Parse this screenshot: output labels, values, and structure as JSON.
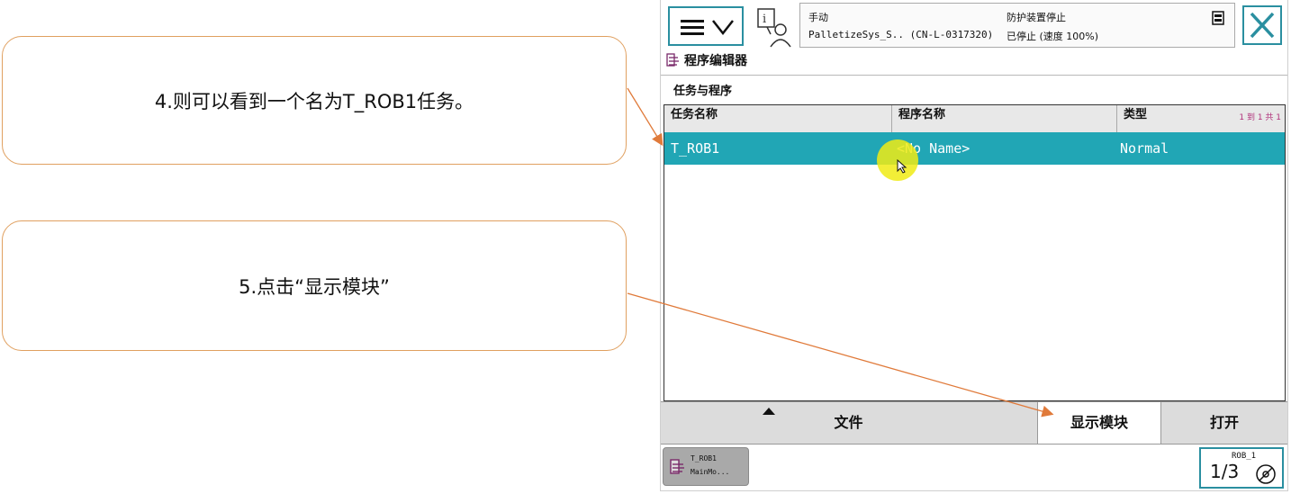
{
  "callouts": {
    "step4": "4.则可以看到一个名为T_ROB1任务。",
    "step5": "5.点击“显示模块”"
  },
  "header": {
    "mode": "手动",
    "system": "PalletizeSys_S.. (CN-L-0317320)",
    "guard": "防护装置停止",
    "state": "已停止 (速度 100%)"
  },
  "window": {
    "title": "程序编辑器",
    "section": "任务与程序"
  },
  "table": {
    "columns": [
      "任务名称",
      "程序名称",
      "类型"
    ],
    "pager": "1 到 1 共 1",
    "rows": [
      {
        "task": "T_ROB1",
        "program": "<No Name>",
        "type": "Normal"
      }
    ]
  },
  "toolbar": {
    "file": "文件",
    "show_modules": "显示模块",
    "open": "打开"
  },
  "taskbar": {
    "task_line1": "T_ROB1",
    "task_line2": "MainMo...",
    "robot": "ROB_1",
    "fraction": "1/3"
  },
  "colors": {
    "accent": "#2a8fa0",
    "selected_row": "#21a6b5",
    "callout_border": "#e0a060"
  }
}
